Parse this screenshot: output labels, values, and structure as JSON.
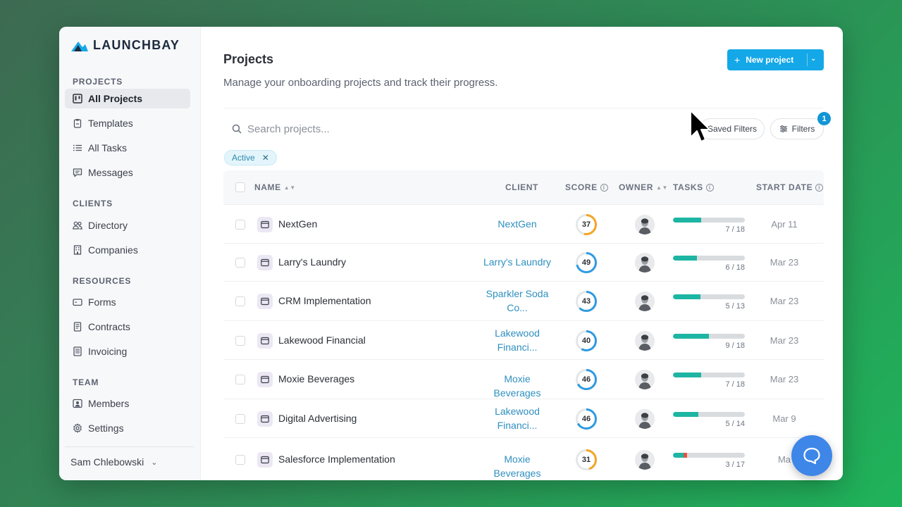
{
  "brand": {
    "name": "LAUNCHBAY",
    "accent": "#14a8e8"
  },
  "sidebar": {
    "sections": [
      {
        "label": "PROJECTS",
        "items": [
          {
            "label": "All Projects",
            "icon": "kanban-icon",
            "active": true
          },
          {
            "label": "Templates",
            "icon": "clipboard-icon"
          },
          {
            "label": "All Tasks",
            "icon": "list-icon"
          },
          {
            "label": "Messages",
            "icon": "message-icon"
          }
        ]
      },
      {
        "label": "CLIENTS",
        "items": [
          {
            "label": "Directory",
            "icon": "people-icon"
          },
          {
            "label": "Companies",
            "icon": "building-icon"
          }
        ]
      },
      {
        "label": "RESOURCES",
        "items": [
          {
            "label": "Forms",
            "icon": "form-icon"
          },
          {
            "label": "Contracts",
            "icon": "document-icon"
          },
          {
            "label": "Invoicing",
            "icon": "invoice-icon"
          }
        ]
      },
      {
        "label": "TEAM",
        "items": [
          {
            "label": "Members",
            "icon": "member-icon"
          },
          {
            "label": "Settings",
            "icon": "gear-icon"
          }
        ]
      }
    ],
    "user": {
      "name": "Sam Chlebowski"
    }
  },
  "header": {
    "title": "Projects",
    "subtitle": "Manage your onboarding projects and track their progress.",
    "new_button": "New project"
  },
  "toolbar": {
    "search_placeholder": "Search projects...",
    "saved_filters": "Saved Filters",
    "filters": "Filters",
    "filters_count": "1",
    "active_chip": "Active"
  },
  "table": {
    "columns": {
      "name": "NAME",
      "client": "CLIENT",
      "score": "SCORE",
      "owner": "OWNER",
      "tasks": "TASKS",
      "start_date": "START DATE"
    },
    "rows": [
      {
        "name": "NextGen",
        "client": "NextGen",
        "score": 37,
        "score_color": "#f3a623",
        "tasks_done": 7,
        "tasks_total": 18,
        "tasks_label": "7 / 18",
        "date": "Apr 11"
      },
      {
        "name": "Larry's Laundry",
        "client": "Larry's Laundry",
        "score": 49,
        "score_color": "#2f9be0",
        "tasks_done": 6,
        "tasks_total": 18,
        "tasks_label": "6 / 18",
        "date": "Mar 23"
      },
      {
        "name": "CRM Implementation",
        "client": "Sparkler Soda Co...",
        "score": 43,
        "score_color": "#2f9be0",
        "tasks_done": 5,
        "tasks_total": 13,
        "tasks_label": "5 / 13",
        "date": "Mar 23"
      },
      {
        "name": "Lakewood Financial",
        "client": "Lakewood Financi...",
        "score": 40,
        "score_color": "#2f9be0",
        "tasks_done": 9,
        "tasks_total": 18,
        "tasks_label": "9 / 18",
        "date": "Mar 23"
      },
      {
        "name": "Moxie Beverages",
        "client": "Moxie Beverages",
        "score": 46,
        "score_color": "#2f9be0",
        "tasks_done": 7,
        "tasks_total": 18,
        "tasks_label": "7 / 18",
        "date": "Mar 23"
      },
      {
        "name": "Digital Advertising",
        "client": "Lakewood Financi...",
        "score": 46,
        "score_color": "#2f9be0",
        "tasks_done": 5,
        "tasks_total": 14,
        "tasks_label": "5 / 14",
        "date": "Mar 9"
      },
      {
        "name": "Salesforce Implementation",
        "client": "Moxie Beverages",
        "score": 31,
        "score_color": "#f3a623",
        "tasks_done": 3,
        "tasks_total": 17,
        "tasks_label": "3 / 17",
        "date": "Ma",
        "overdue": true
      }
    ]
  }
}
